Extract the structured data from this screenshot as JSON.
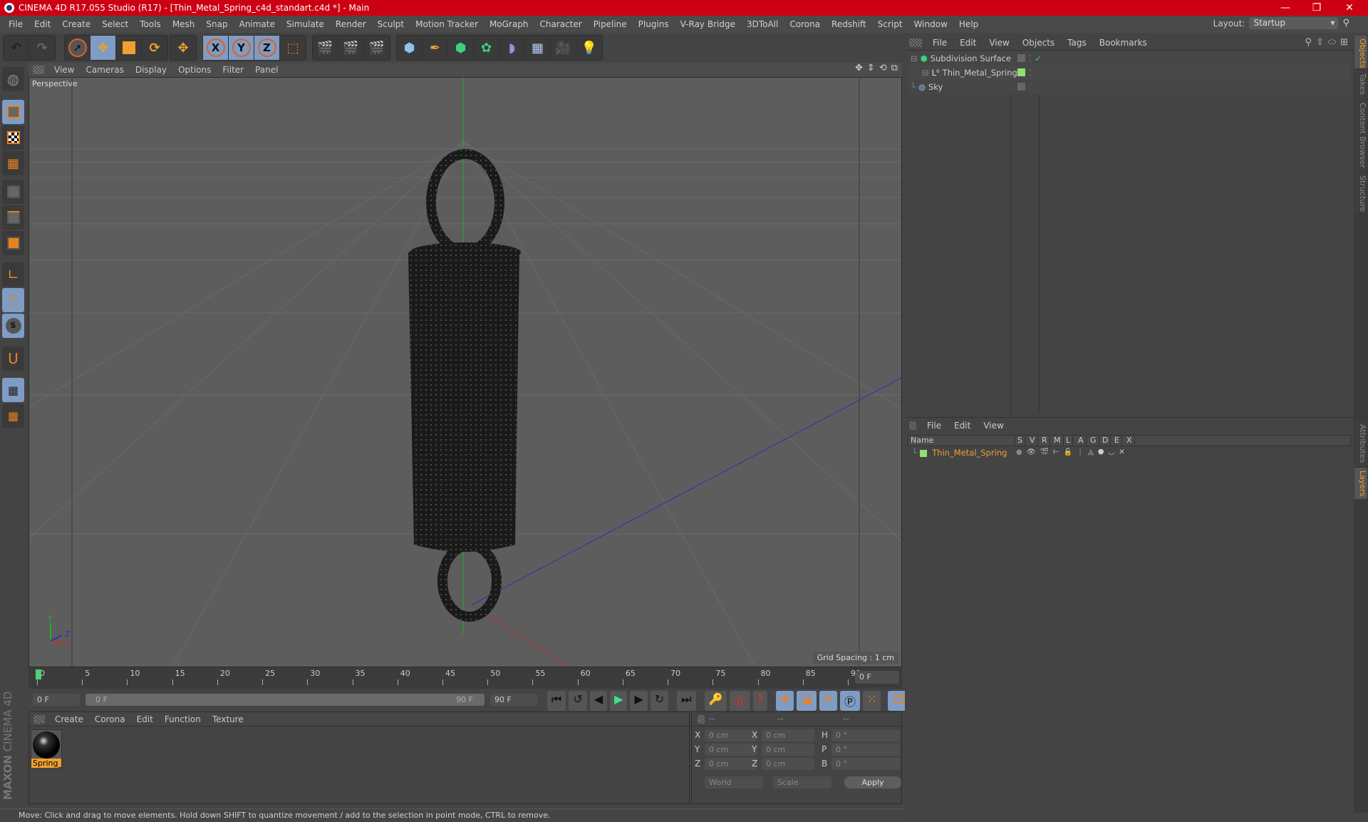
{
  "window": {
    "title": "CINEMA 4D R17.055 Studio (R17) - [Thin_Metal_Spring_c4d_standart.c4d *] - Main",
    "controls": [
      "minimize",
      "restore",
      "close"
    ]
  },
  "menubar": [
    "File",
    "Edit",
    "Create",
    "Select",
    "Tools",
    "Mesh",
    "Snap",
    "Animate",
    "Simulate",
    "Render",
    "Sculpt",
    "Motion Tracker",
    "MoGraph",
    "Character",
    "Pipeline",
    "Plugins",
    "V-Ray Bridge",
    "3DToAll",
    "Corona",
    "Redshift",
    "Script",
    "Window",
    "Help"
  ],
  "layout": {
    "label": "Layout:",
    "value": "Startup"
  },
  "toolbar": {
    "groups": [
      [
        "undo-icon",
        "redo-icon"
      ],
      [
        "select-icon",
        "move-icon",
        "scale-icon",
        "rotate-icon"
      ],
      [
        "live-move-icon"
      ],
      [
        "x-axis-icon",
        "y-axis-icon",
        "z-axis-icon",
        "coordinate-system-icon"
      ],
      [
        "render-view-icon",
        "render-picture-viewer-icon",
        "render-settings-icon"
      ],
      [
        "cube-icon",
        "pen-icon",
        "subdivision-icon",
        "array-icon",
        "deformer-icon",
        "floor-icon",
        "camera-icon",
        "light-icon"
      ]
    ],
    "axis_labels": [
      "X",
      "Y",
      "Z"
    ]
  },
  "left_tools": [
    "make-editable",
    "model-mode",
    "texture-mode",
    "workplane-mode",
    "points-mode",
    "edges-mode",
    "polygons-mode",
    "axis-mode",
    "tweak-mode",
    "solo-mode",
    "snap-mode",
    "lock-workplane",
    "workplane-align"
  ],
  "viewport": {
    "menu": [
      "View",
      "Cameras",
      "Display",
      "Options",
      "Filter",
      "Panel"
    ],
    "camera_label": "Perspective",
    "grid_spacing": "Grid Spacing : 1 cm",
    "axes": {
      "x": "X",
      "y": "Y",
      "z": "Z"
    },
    "colors": {
      "x_axis": "#c0302a",
      "y_axis": "#22b022",
      "z_axis": "#2a34b0"
    }
  },
  "timeline": {
    "ticks": [
      "0",
      "5",
      "10",
      "15",
      "20",
      "25",
      "30",
      "35",
      "40",
      "45",
      "50",
      "55",
      "60",
      "65",
      "70",
      "75",
      "80",
      "85",
      "90"
    ],
    "current_frame": "0 F",
    "start_field": "0 F",
    "range_start": "0 F",
    "range_end": "90 F",
    "end_field": "90 F"
  },
  "material_manager": {
    "menu": [
      "Create",
      "Corona",
      "Edit",
      "Function",
      "Texture"
    ],
    "materials": [
      {
        "name": "Spring_"
      }
    ]
  },
  "coordinates": {
    "headers": [
      "--",
      "--",
      "--"
    ],
    "rows": [
      {
        "l1": "X",
        "v1": "0 cm",
        "l2": "X",
        "v2": "0 cm",
        "l3": "H",
        "v3": "0 °"
      },
      {
        "l1": "Y",
        "v1": "0 cm",
        "l2": "Y",
        "v2": "0 cm",
        "l3": "P",
        "v3": "0 °"
      },
      {
        "l1": "Z",
        "v1": "0 cm",
        "l2": "Z",
        "v2": "0 cm",
        "l3": "B",
        "v3": "0 °"
      }
    ],
    "space": "World",
    "mode": "Scale",
    "apply_label": "Apply"
  },
  "object_manager": {
    "menu": [
      "File",
      "Edit",
      "View",
      "Objects",
      "Tags",
      "Bookmarks"
    ],
    "objects": [
      {
        "name": "Subdivision Surface",
        "indent": 0,
        "icon": "subdivision-icon",
        "check": "✓"
      },
      {
        "name": "Thin_Metal_Spring",
        "indent": 1,
        "icon": "null-icon",
        "layer_color": "#8fe070"
      },
      {
        "name": "Sky",
        "indent": 0,
        "icon": "sky-icon"
      }
    ]
  },
  "layer_manager": {
    "menu": [
      "File",
      "Edit",
      "View"
    ],
    "columns": [
      "Name",
      "S",
      "V",
      "R",
      "M",
      "L",
      "A",
      "G",
      "D",
      "E",
      "X"
    ],
    "layers": [
      {
        "name": "Thin_Metal_Spring",
        "color": "#8fe070"
      }
    ]
  },
  "side_tabs": {
    "top": [
      "Objects",
      "Takes",
      "Content Browser",
      "Structure"
    ],
    "bottom": [
      "Attributes",
      "Layers"
    ]
  },
  "status": "Move: Click and drag to move elements. Hold down SHIFT to quantize movement / add to the selection in point mode, CTRL to remove.",
  "branding": {
    "maxon": "MAXON",
    "product": "CINEMA 4D"
  },
  "accent": "#f0a030"
}
